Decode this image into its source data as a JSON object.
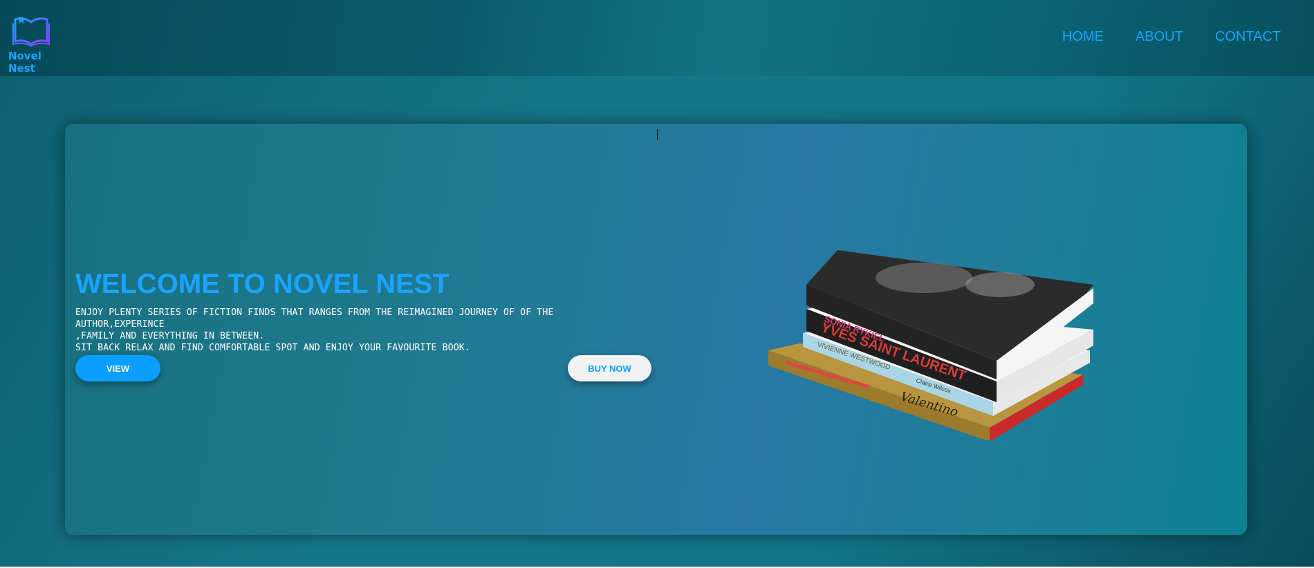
{
  "header": {
    "logo_text": "Novel Nest",
    "nav": [
      "HOME",
      "ABOUT",
      "CONTACT"
    ]
  },
  "hero": {
    "title": "WELCOME TO NOVEL NEST",
    "description_lines": [
      "ENJOY PLENTY SERIES OF FICTION FINDS THAT RANGES FROM THE REIMAGINED JOURNEY OF OF THE AUTHOR,EXPERINCE",
      ",FAMILY AND EVERYTHING IN BETWEEN.",
      "SIT BACK RELAX AND FIND COMFORTABLE SPOT AND ENJOY YOUR FAVOURITE BOOK."
    ],
    "view_label": "VIEW",
    "buy_label": "BUY NOW"
  },
  "books_image": {
    "spine_titles": [
      "SONIA RYKIEL",
      "YVES SAINT LAURENT",
      "VIVIENNE WESTWOOD",
      "Valentino"
    ],
    "author": "Claire Wilcox"
  },
  "colors": {
    "accent": "#1aa3ff",
    "button_view_bg": "#0a9eff",
    "button_buy_bg": "#f2f2f2",
    "header_bg": "#064a58"
  },
  "icons": {
    "logo": "open-book-icon"
  }
}
